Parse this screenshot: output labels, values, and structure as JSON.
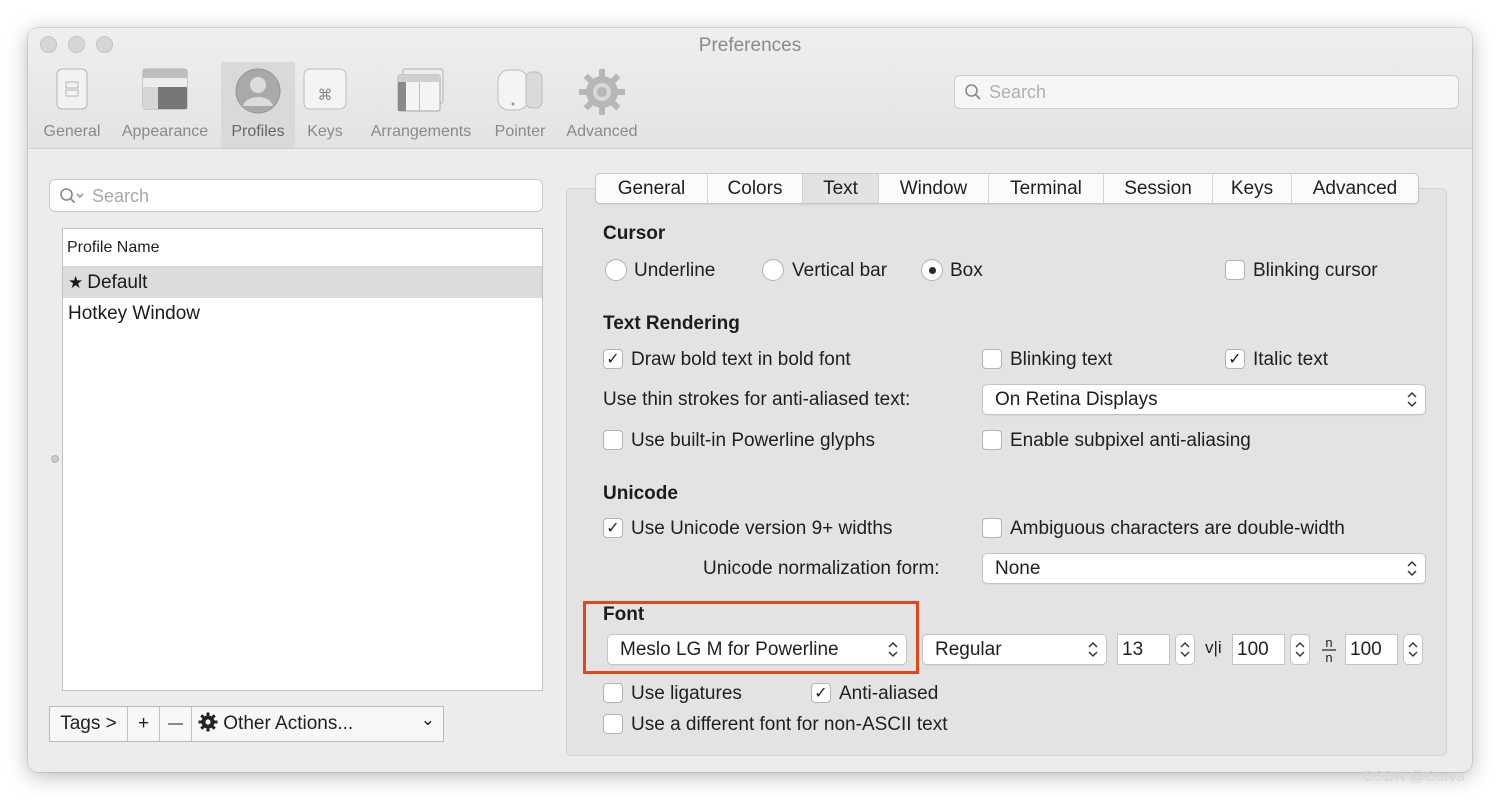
{
  "window": {
    "title": "Preferences"
  },
  "toolbar": {
    "items": [
      {
        "label": "General",
        "icon": "switch-panel-icon"
      },
      {
        "label": "Appearance",
        "icon": "window-appearance-icon"
      },
      {
        "label": "Profiles",
        "icon": "person-silhouette-icon",
        "selected": true
      },
      {
        "label": "Keys",
        "icon": "command-key-icon"
      },
      {
        "label": "Arrangements",
        "icon": "window-arrangement-icon"
      },
      {
        "label": "Pointer",
        "icon": "mouse-icon"
      },
      {
        "label": "Advanced",
        "icon": "gear-icon"
      }
    ],
    "search_placeholder": "Search"
  },
  "profiles": {
    "search_placeholder": "Search",
    "column_header": "Profile Name",
    "rows": [
      {
        "name": "Default",
        "is_default": true,
        "selected": true
      },
      {
        "name": "Hotkey Window"
      }
    ],
    "bottom": {
      "tags": "Tags >",
      "add": "+",
      "remove": "—",
      "other_actions": "Other Actions...",
      "dropdown_chevron": "⌄"
    }
  },
  "tabs": [
    {
      "label": "General"
    },
    {
      "label": "Colors"
    },
    {
      "label": "Text",
      "active": true
    },
    {
      "label": "Window"
    },
    {
      "label": "Terminal"
    },
    {
      "label": "Session"
    },
    {
      "label": "Keys"
    },
    {
      "label": "Advanced"
    }
  ],
  "cursor": {
    "heading": "Cursor",
    "options": [
      "Underline",
      "Vertical bar",
      "Box"
    ],
    "selected": "Box",
    "blinking_label": "Blinking cursor",
    "blinking": false
  },
  "text_rendering": {
    "heading": "Text Rendering",
    "draw_bold": {
      "label": "Draw bold text in bold font",
      "checked": true
    },
    "blinking_text": {
      "label": "Blinking text",
      "checked": false
    },
    "italic_text": {
      "label": "Italic text",
      "checked": true
    },
    "thin_strokes_label": "Use thin strokes for anti-aliased text:",
    "thin_strokes_value": "On Retina Displays",
    "powerline": {
      "label": "Use built-in Powerline glyphs",
      "checked": false
    },
    "subpixel": {
      "label": "Enable subpixel anti-aliasing",
      "checked": false
    }
  },
  "unicode": {
    "heading": "Unicode",
    "version9": {
      "label": "Use Unicode version 9+ widths",
      "checked": true
    },
    "ambiguous": {
      "label": "Ambiguous characters are double-width",
      "checked": false
    },
    "normalization_label": "Unicode normalization form:",
    "normalization_value": "None"
  },
  "font": {
    "heading": "Font",
    "family": "Meslo LG M for Powerline",
    "weight": "Regular",
    "size": "13",
    "h_spacing_icon": "v|i",
    "h_spacing": "100",
    "v_spacing_icon": "n/n",
    "v_spacing": "100",
    "ligatures": {
      "label": "Use ligatures",
      "checked": false
    },
    "anti_aliased": {
      "label": "Anti-aliased",
      "checked": true
    },
    "non_ascii": {
      "label": "Use a different font for non-ASCII text",
      "checked": false
    }
  },
  "checkmark": "✓",
  "select_chevron": "⌃⌄",
  "stepper_arrows": "⌃⌄",
  "annotation_color": "#e2461c",
  "watermark": "CSDN @Curva"
}
